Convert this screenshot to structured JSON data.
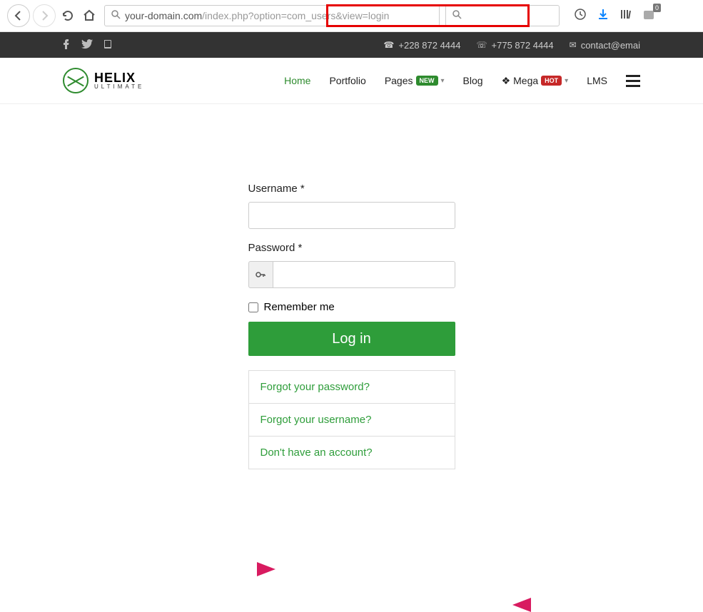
{
  "browser": {
    "url_dark": "your-domain.com",
    "url_grey": "/index.php?option=com_users&view=login",
    "ext_badge": "0"
  },
  "topbar": {
    "phone1": "+228 872 4444",
    "phone2": "+775 872 4444",
    "email": "contact@emai"
  },
  "logo": {
    "main": "HELIX",
    "sub": "ULTIMATE"
  },
  "nav": {
    "home": "Home",
    "portfolio": "Portfolio",
    "pages": "Pages",
    "pages_badge": "NEW",
    "blog": "Blog",
    "mega": "Mega",
    "mega_badge": "HOT",
    "lms": "LMS"
  },
  "form": {
    "username_label": "Username *",
    "password_label": "Password *",
    "remember_label": "Remember me",
    "login_btn": "Log in",
    "forgot_pw": "Forgot your password?",
    "forgot_un": "Forgot your username?",
    "no_account": "Don't have an account?"
  }
}
